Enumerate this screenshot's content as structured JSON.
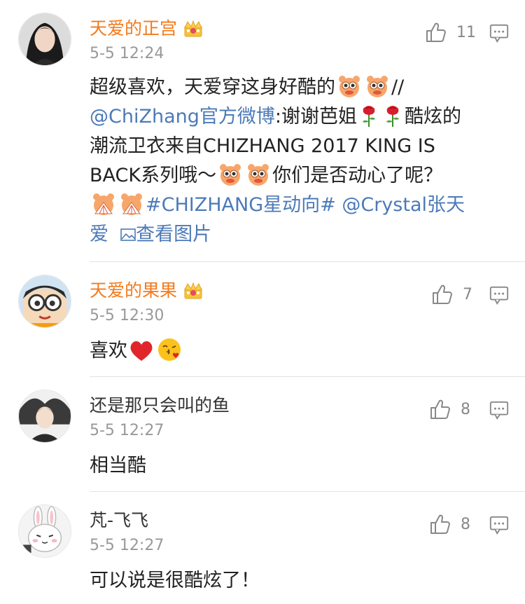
{
  "comments": [
    {
      "user": "天爱的正宫",
      "time": "5-5 12:24",
      "likes": "11",
      "vip": true,
      "text_parts": {
        "p1": "超级喜欢，天爱穿这身好酷的",
        "p2": "//",
        "mention1": "@ChiZhang官方微博",
        "p3": ":谢谢芭姐",
        "p4": "酷炫的",
        "p5": "潮流卫衣来自CHIZHANG 2017 KING IS",
        "p6": "BACK系列哦～",
        "p7": "你们是否动心了呢？",
        "hashtag": "#CHIZHANG星动向#",
        "mention2": "@Crystal张天",
        "mention2b": "爱",
        "view_image": "查看图片"
      }
    },
    {
      "user": "天爱的果果",
      "time": "5-5 12:30",
      "likes": "7",
      "vip": true,
      "text": "喜欢"
    },
    {
      "user": "还是那只会叫的鱼",
      "time": "5-5 12:27",
      "likes": "8",
      "vip": false,
      "text": "相当酷"
    },
    {
      "user": "芃-飞飞",
      "time": "5-5 12:27",
      "likes": "8",
      "vip": false,
      "text": "可以说是很酷炫了！"
    }
  ],
  "icons": {
    "like": "thumbs-up-icon",
    "reply": "comment-icon",
    "crown": "crown-icon"
  },
  "colors": {
    "vip_name": "#f37b1d",
    "link": "#4c7ab8",
    "meta": "#999999"
  }
}
